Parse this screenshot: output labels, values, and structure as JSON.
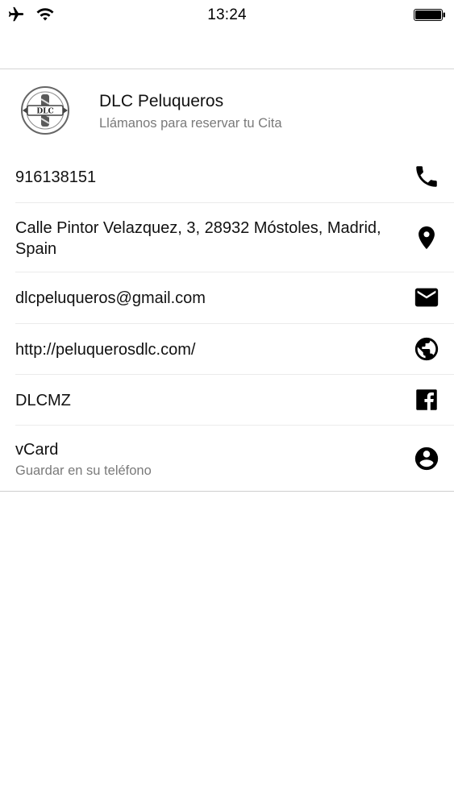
{
  "status_bar": {
    "time": "13:24",
    "left_icons": [
      "airplane-icon",
      "wifi-icon"
    ],
    "right_icons": [
      "battery-icon"
    ]
  },
  "business": {
    "name": "DLC Peluqueros",
    "subtitle": "Llámanos para reservar tu Cita",
    "logo_text": "DLC"
  },
  "contacts": [
    {
      "text": "916138151",
      "icon": "phone-icon"
    },
    {
      "text": "Calle Pintor Velazquez, 3, 28932 Móstoles, Madrid, Spain",
      "icon": "location-pin-icon"
    },
    {
      "text": "dlcpeluqueros@gmail.com",
      "icon": "mail-icon"
    },
    {
      "text": "http://peluquerosdlc.com/",
      "icon": "globe-icon"
    },
    {
      "text": "DLCMZ",
      "icon": "facebook-icon"
    },
    {
      "text": "vCard",
      "subtext": "Guardar en su teléfono",
      "icon": "contact-person-icon"
    }
  ],
  "colors": {
    "text": "#111111",
    "secondary_text": "#7a7a7a",
    "divider": "#ebebeb",
    "icon": "#000000"
  }
}
